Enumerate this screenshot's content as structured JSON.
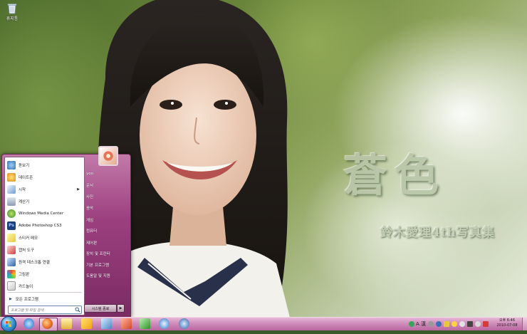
{
  "desktop": {
    "recycle_bin_label": "휴지통",
    "wallpaper_title": "蒼色",
    "wallpaper_subtitle": "鈴木愛理4th写真集"
  },
  "start_menu": {
    "pinned_items": [
      {
        "label": "돋보기",
        "icon": "magnifier-icon"
      },
      {
        "label": "데이트존",
        "icon": "app-icon"
      },
      {
        "label": "시작",
        "icon": "getting-started-icon",
        "has_submenu": true
      },
      {
        "label": "계산기",
        "icon": "calculator-icon"
      },
      {
        "label": "Windows Media Center",
        "icon": "media-center-icon"
      },
      {
        "label": "Adobe Photoshop CS3",
        "icon": "photoshop-icon"
      },
      {
        "label": "스티커 메모",
        "icon": "sticky-notes-icon"
      },
      {
        "label": "캡처 도구",
        "icon": "snipping-tool-icon"
      },
      {
        "label": "원격 데스크톱 연결",
        "icon": "remote-desktop-icon"
      },
      {
        "label": "그림판",
        "icon": "paint-icon"
      },
      {
        "label": "카드놀이",
        "icon": "solitaire-icon"
      }
    ],
    "all_programs_label": "모든 프로그램",
    "search_placeholder": "프로그램 및 파일 검색",
    "right_items": [
      "yoo",
      "문서",
      "사진",
      "음악",
      "게임",
      "컴퓨터",
      "제어판",
      "장치 및 프린터",
      "기본 프로그램",
      "도움말 및 지원"
    ],
    "shutdown_label": "시스템 종료"
  },
  "taskbar": {
    "pinned_icons": [
      "internet-explorer-icon",
      "firefox-icon",
      "folder-icon",
      "windows-explorer-icon",
      "file-manager-icon",
      "powerpoint-icon",
      "excel-icon",
      "media-player-icon",
      "network-icon"
    ],
    "ime_label": "A 漢",
    "clock": {
      "time": "오후 6:46",
      "date": "2010-07-08"
    }
  },
  "colors": {
    "taskbar_accent": "#cf8dba",
    "start_menu_accent": "#9c3f7f"
  }
}
